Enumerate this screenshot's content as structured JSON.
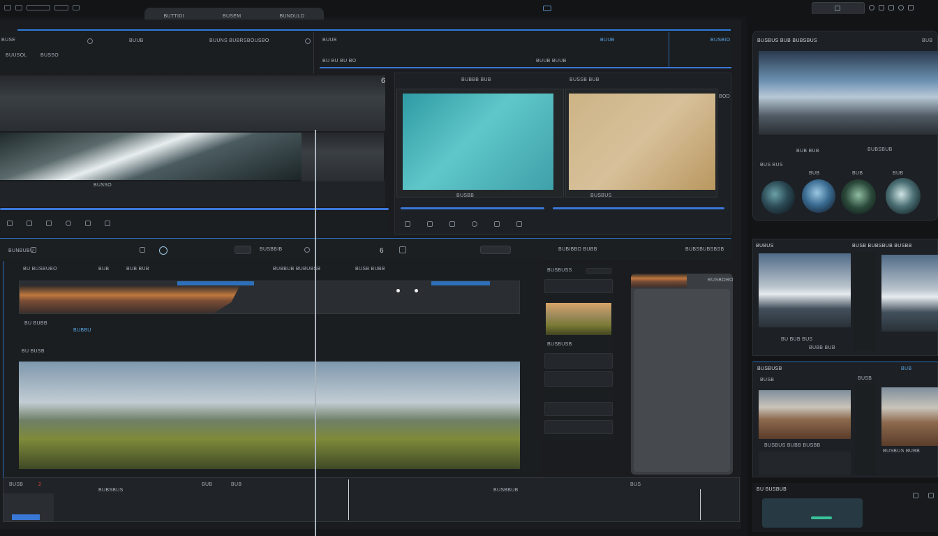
{
  "top_bar": {
    "center_tabs": [
      "BUTTIDI",
      "BUSEM",
      "BUNDULD"
    ],
    "center_icon": "dual-square-icon",
    "right_button": "",
    "right_icons": [
      "clock-icon",
      "capture-icon",
      "gear-icon",
      "sync-icon",
      "window-icon"
    ]
  },
  "source_panel": {
    "title": "BUSE",
    "row_labels": [
      "BUUSOL",
      "BUSSO"
    ],
    "center_label": "BUUNS BUBRSBOUSBO",
    "right_label": "BUSBIO",
    "right_small": "BUUB",
    "bottom_labels": [
      "BU BU BU BO",
      "BUUB BUUB"
    ],
    "number": "6"
  },
  "clip_panel": {
    "top_label": "BUBBB BUB",
    "clip_labels": [
      "BUSSB BUB",
      "BUSBB"
    ],
    "corner": "BOD",
    "filmstrip_label": "BUSBUS"
  },
  "mid_bar": {
    "left": "BUNBUBU",
    "center_label": "6",
    "right_labels": [
      "BUSBBIB",
      "BUBIBBO BUBB",
      "BUBSBUBSBSB"
    ]
  },
  "timeline_top": {
    "labels": [
      "BU BUSBUBO",
      "BUB",
      "BUB BUB",
      "BUBBUB BUBUBSB",
      "BUSB BUBB"
    ],
    "track_labels": [
      "BU BUBB",
      "BUBBU",
      "BU BUSB"
    ]
  },
  "preview": {
    "labels": [
      "BUSBUSS",
      "BUSBUSB"
    ],
    "label_right": "BUSBOBO"
  },
  "bottom_track": {
    "left_label": "BUSB",
    "red_number": "2",
    "labels": [
      "BUBSBUS",
      "BUB",
      "BUB",
      "BUSBBUB",
      "BUS"
    ]
  },
  "right_top": {
    "title": "BUSBUS BUB BUBSBUS",
    "corner": "BUB",
    "buttons": [
      "BUB BUB",
      "BUBSBUB"
    ],
    "label_row": "BUS BUS",
    "knob_labels": [
      "BUB",
      "BUB",
      "BUB",
      "BUB"
    ]
  },
  "right_mid": {
    "title": "BUBUS",
    "right_title": "BUSB BUBSBUB BUSBB",
    "thumb_labels": [
      "BU BUB BUS",
      "BUBB BUB"
    ]
  },
  "right_bottom": {
    "title": "BUSBUSB",
    "subtitle": "BUSB",
    "badge": "BUB",
    "thumb_labels": [
      "BUSBUS BUBB BUSBB",
      "BUSBUS BUBB"
    ],
    "footer": "BU BUSBUB",
    "ids": [
      "BUSB"
    ]
  },
  "colors": {
    "accent": "#3a78d8",
    "background": "#15171a",
    "panel": "#1d2024"
  }
}
